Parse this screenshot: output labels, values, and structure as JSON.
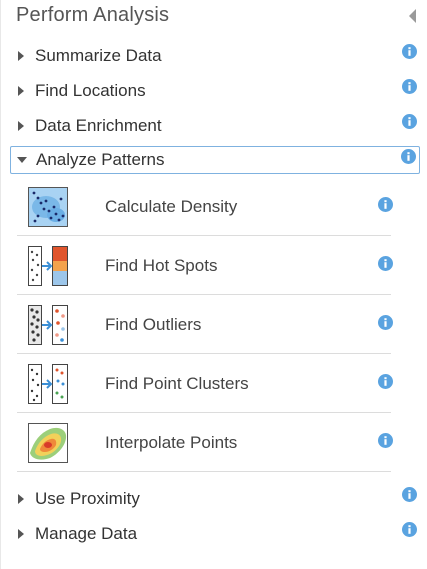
{
  "panel": {
    "title": "Perform Analysis",
    "categories": [
      {
        "label": "Summarize Data",
        "state": "collapsed"
      },
      {
        "label": "Find Locations",
        "state": "collapsed"
      },
      {
        "label": "Data Enrichment",
        "state": "collapsed"
      },
      {
        "label": "Analyze Patterns",
        "state": "expanded"
      },
      {
        "label": "Use Proximity",
        "state": "collapsed"
      },
      {
        "label": "Manage Data",
        "state": "collapsed"
      }
    ],
    "tools": [
      {
        "label": "Calculate Density",
        "icon": "density-icon"
      },
      {
        "label": "Find Hot Spots",
        "icon": "hot-spots-icon"
      },
      {
        "label": "Find Outliers",
        "icon": "outliers-icon"
      },
      {
        "label": "Find Point Clusters",
        "icon": "point-clusters-icon"
      },
      {
        "label": "Interpolate Points",
        "icon": "interpolate-icon"
      }
    ]
  },
  "colors": {
    "info": "#5aa3e0",
    "expanded_border": "#7fb2e0",
    "divider": "#dcdcdc"
  }
}
